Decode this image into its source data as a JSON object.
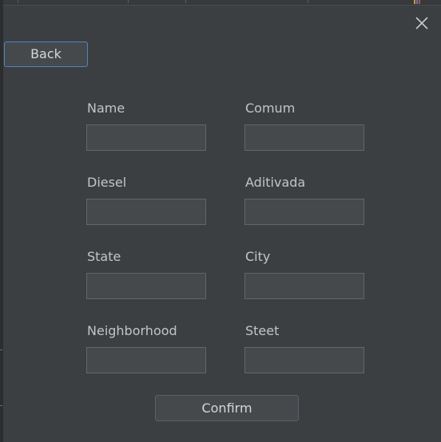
{
  "dialog": {
    "close_icon": "close-icon",
    "back_label": "Back",
    "confirm_label": "Confirm"
  },
  "form": {
    "fields": [
      {
        "label": "Name",
        "value": ""
      },
      {
        "label": "Comum",
        "value": ""
      },
      {
        "label": "Diesel",
        "value": ""
      },
      {
        "label": "Aditivada",
        "value": ""
      },
      {
        "label": "State",
        "value": ""
      },
      {
        "label": "City",
        "value": ""
      },
      {
        "label": "Neighborhood",
        "value": ""
      },
      {
        "label": "Steet",
        "value": ""
      }
    ]
  },
  "colors": {
    "background": "#3c3f41",
    "field_background": "#45494b",
    "focus_border": "#4e83c4",
    "text": "#c4c4c4"
  }
}
